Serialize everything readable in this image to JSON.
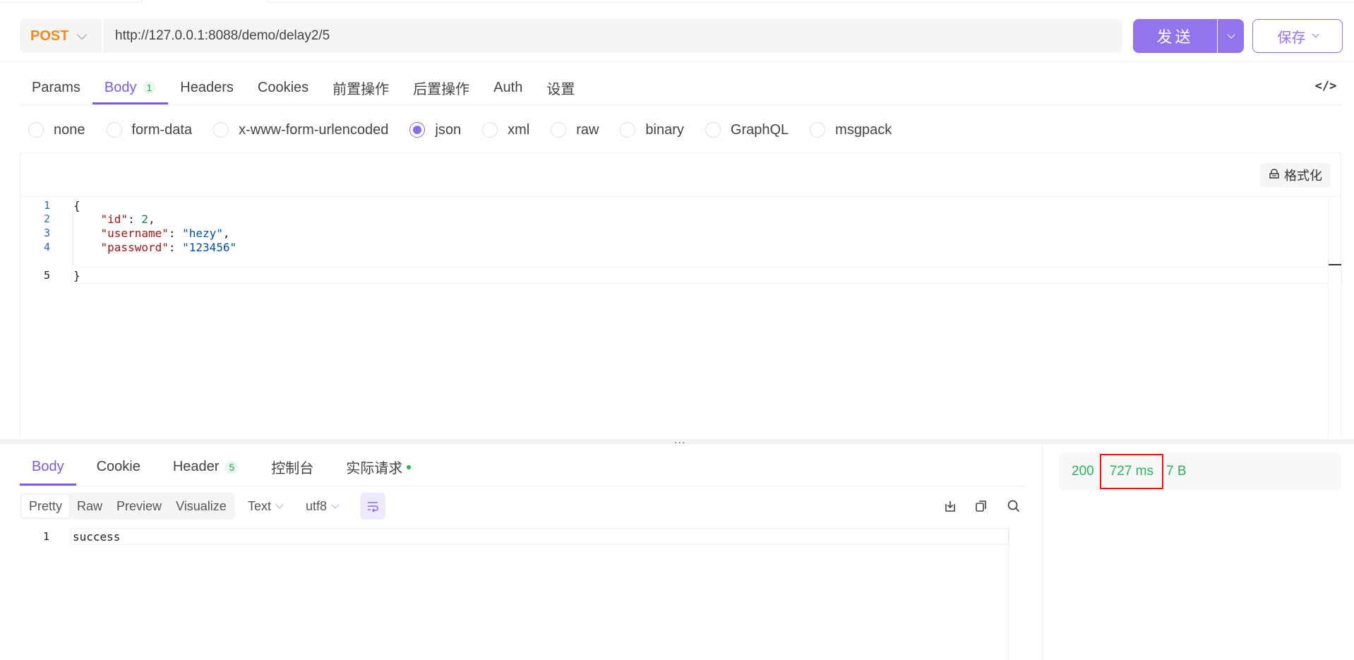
{
  "request": {
    "method": "POST",
    "url": "http://127.0.0.1:8088/demo/delay2/5",
    "send_label": "发送",
    "save_label": "保存"
  },
  "request_tabs": [
    {
      "label": "Params"
    },
    {
      "label": "Body",
      "badge": "1",
      "active": true
    },
    {
      "label": "Headers"
    },
    {
      "label": "Cookies"
    },
    {
      "label": "前置操作"
    },
    {
      "label": "后置操作"
    },
    {
      "label": "Auth"
    },
    {
      "label": "设置"
    }
  ],
  "code_toggle_icon": "code-icon",
  "body_types": [
    {
      "label": "none"
    },
    {
      "label": "form-data"
    },
    {
      "label": "x-www-form-urlencoded"
    },
    {
      "label": "json",
      "checked": true
    },
    {
      "label": "xml"
    },
    {
      "label": "raw"
    },
    {
      "label": "binary"
    },
    {
      "label": "GraphQL"
    },
    {
      "label": "msgpack"
    }
  ],
  "editor": {
    "format_label": "格式化",
    "line_numbers": [
      "1",
      "2",
      "3",
      "4",
      "5"
    ],
    "fields": {
      "id_key": "\"id\"",
      "id_value": "2",
      "username_key": "\"username\"",
      "username_value": "\"hezy\"",
      "password_key": "\"password\"",
      "password_value": "\"123456\""
    },
    "open_brace": "{",
    "close_brace": "}"
  },
  "splitter_label": "...",
  "response_tabs": [
    {
      "label": "Body",
      "active": true
    },
    {
      "label": "Cookie"
    },
    {
      "label": "Header",
      "badge": "5"
    },
    {
      "label": "控制台"
    },
    {
      "label": "实际请求",
      "dot": true
    }
  ],
  "view_modes": [
    "Pretty",
    "Raw",
    "Preview",
    "Visualize"
  ],
  "active_view_mode": "Pretty",
  "format_select": "Text",
  "encoding_select": "utf8",
  "response": {
    "line_numbers": [
      "1"
    ],
    "lines": [
      "success"
    ]
  },
  "stats": {
    "status": "200",
    "time": "727 ms",
    "size": "7 B"
  },
  "colors": {
    "accent": "#9373ee",
    "method": "#f7881e",
    "success": "#2bb35b",
    "highlight_box": "#ee1111"
  }
}
